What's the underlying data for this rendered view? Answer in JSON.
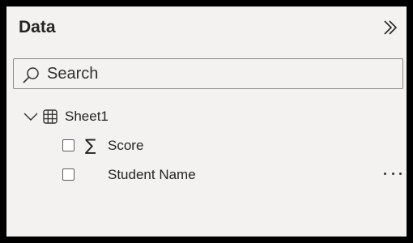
{
  "pane": {
    "title": "Data",
    "collapse_icon": "double-chevron-right-icon"
  },
  "search": {
    "placeholder": "Search",
    "value": "",
    "icon": "search-icon"
  },
  "tree": {
    "table": {
      "label": "Sheet1",
      "expanded": true,
      "icon": "table-icon"
    },
    "fields": [
      {
        "label": "Score",
        "checked": false,
        "icon": "sigma-icon",
        "icon_glyph": "∑"
      },
      {
        "label": "Student Name",
        "checked": false,
        "icon": "",
        "more_icon": "ellipsis-icon"
      }
    ]
  },
  "colors": {
    "pane_background": "#f3f2f1",
    "frame": "#000000",
    "text": "#252423",
    "border": "#8a8886"
  }
}
